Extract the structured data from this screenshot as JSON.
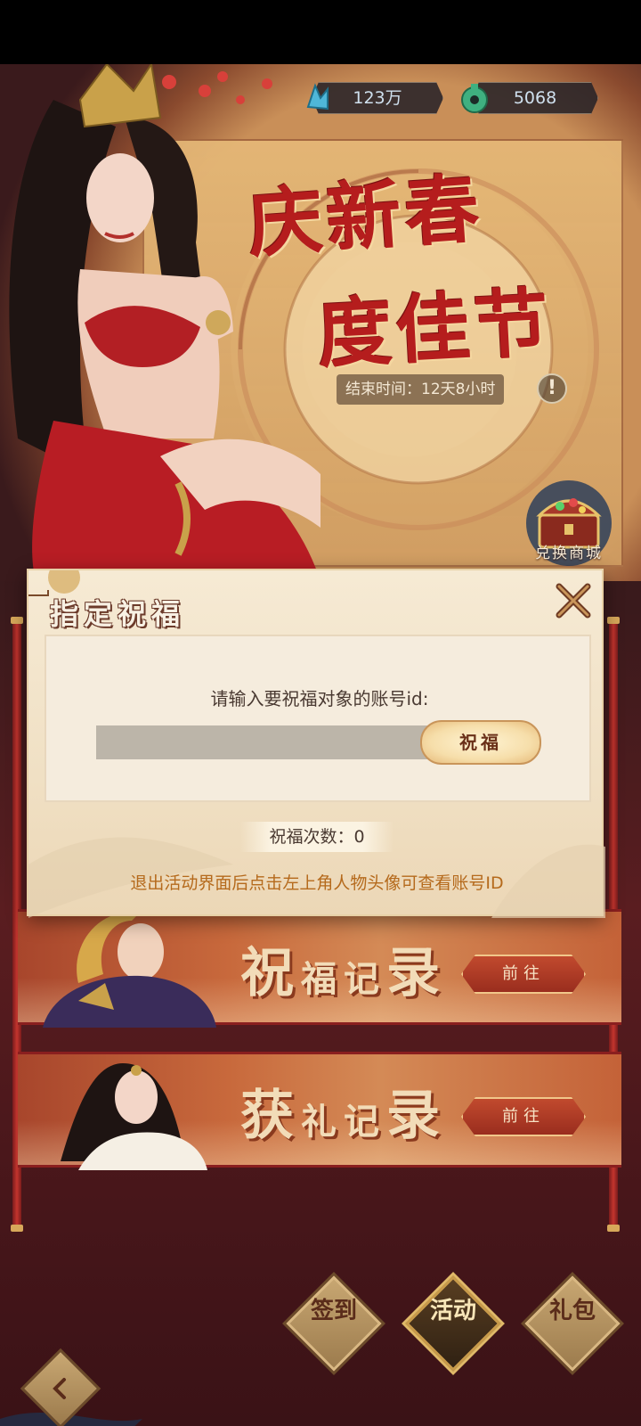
{
  "currency": {
    "gems": "123万",
    "coins": "5068"
  },
  "banner": {
    "title_line1": "庆新春",
    "title_line2": "度佳节",
    "end_time": "结束时间：12天8小时",
    "info_symbol": "!",
    "shop_label": "兑换商城"
  },
  "modal": {
    "title": "指定祝福",
    "prompt": "请输入要祝福对象的账号id:",
    "input_value": "",
    "bless_button": "祝福",
    "count_text": "祝福次数：0",
    "hint": "退出活动界面后点击左上角人物头像可查看账号ID"
  },
  "records": [
    {
      "title_big1": "祝",
      "title_small": "福记",
      "title_big2": "录",
      "button": "前往"
    },
    {
      "title_big1": "获",
      "title_small": "礼记",
      "title_big2": "录",
      "button": "前往"
    }
  ],
  "nav": {
    "sign_in": "签到",
    "activity": "活动",
    "gift": "礼包"
  },
  "colors": {
    "accent_red": "#b51d1d",
    "gold": "#e0b968",
    "hint_orange": "#b56a1c"
  },
  "icons": [
    "gem-icon",
    "jade-coin-icon",
    "info-icon",
    "treasure-chest-icon",
    "close-x-icon",
    "back-icon"
  ]
}
